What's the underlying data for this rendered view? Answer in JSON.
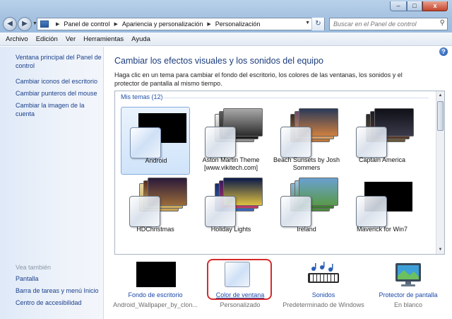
{
  "window": {
    "caption_buttons": {
      "minimize": "–",
      "maximize": "□",
      "close": "x"
    }
  },
  "address_bar": {
    "crumbs": [
      "Panel de control",
      "Apariencia y personalización",
      "Personalización"
    ],
    "back_glyph": "◀",
    "forward_glyph": "▶",
    "refresh_glyph": "↻"
  },
  "search": {
    "placeholder": "Buscar en el Panel de control"
  },
  "menu": [
    "Archivo",
    "Edición",
    "Ver",
    "Herramientas",
    "Ayuda"
  ],
  "left_nav": {
    "links": [
      "Ventana principal del Panel de control",
      "Cambiar iconos del escritorio",
      "Cambiar punteros del mouse",
      "Cambiar la imagen de la cuenta"
    ],
    "see_also_label": "Vea también",
    "see_also": [
      "Pantalla",
      "Barra de tareas y menú Inicio",
      "Centro de accesibilidad"
    ]
  },
  "main": {
    "title": "Cambiar los efectos visuales y los sonidos del equipo",
    "description": "Haga clic en un tema para cambiar el fondo del escritorio, los colores de las ventanas, los sonidos y el protector de pantalla al mismo tiempo.",
    "group_header": "Mis temas (12)",
    "themes": [
      {
        "name": "Android",
        "selected": true
      },
      {
        "name": "Aston Martin Theme [www.vikitech.com]",
        "selected": false
      },
      {
        "name": "Beach Sunsets by Josh Sommers",
        "selected": false
      },
      {
        "name": "Captain America",
        "selected": false
      },
      {
        "name": "HDChristmas",
        "selected": false
      },
      {
        "name": "Holiday Lights",
        "selected": false
      },
      {
        "name": "Ireland",
        "selected": false
      },
      {
        "name": "Maverick for Win7",
        "selected": false
      }
    ]
  },
  "settings": [
    {
      "label": "Fondo de escritorio",
      "sub": "Android_Wallpaper_by_clon..."
    },
    {
      "label": "Color de ventana",
      "sub": "Personalizado"
    },
    {
      "label": "Sonidos",
      "sub": "Predeterminado de Windows"
    },
    {
      "label": "Protector de pantalla",
      "sub": "En blanco"
    }
  ],
  "colors": {
    "link": "#1b49a8",
    "title": "#1d3d7d",
    "highlight_ring": "#d62a2a",
    "selected_tile": "#cfe3fa"
  }
}
